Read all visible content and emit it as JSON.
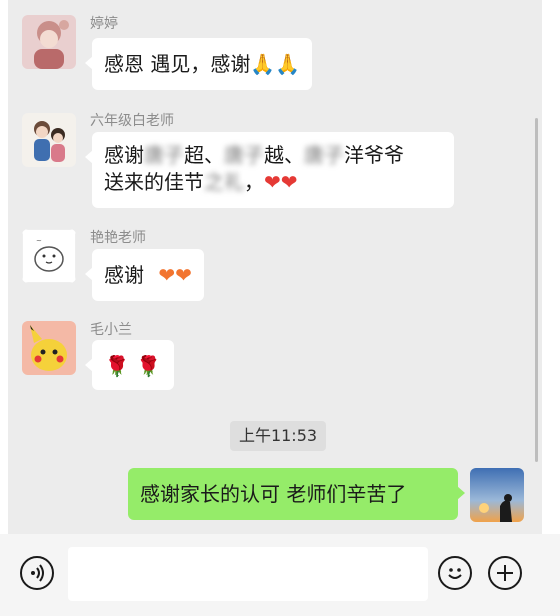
{
  "messages": [
    {
      "sender": "婷婷",
      "segments": [
        {
          "text": "感恩 遇见，感谢"
        },
        {
          "text": "🙏🙏"
        }
      ]
    },
    {
      "sender": "六年级白老师",
      "line1_pre": "感谢",
      "line1_blur1": "唐子",
      "line1_mid1": "超、",
      "line1_blur2": "唐子",
      "line1_mid2": "越、",
      "line1_blur3": "唐子",
      "line1_post": "洋爷爷",
      "line2_pre": "送来的佳节",
      "line2_blur": "之礼",
      "line2_post": "，",
      "hearts": "❤❤"
    },
    {
      "sender": "艳艳老师",
      "text": "感谢",
      "hearts": "❤❤"
    },
    {
      "sender": "毛小兰",
      "text": "🌹 🌹"
    }
  ],
  "timestamp": "上午11:53",
  "own_message": "感谢家长的认可 老师们辛苦了",
  "input": {
    "placeholder": ""
  },
  "colors": {
    "chat_bg": "#ececec",
    "own_bubble": "#95ec69",
    "bubble": "#ffffff"
  },
  "icons": {
    "voice": "voice-icon",
    "emoji": "emoji-icon",
    "add": "add-icon"
  }
}
